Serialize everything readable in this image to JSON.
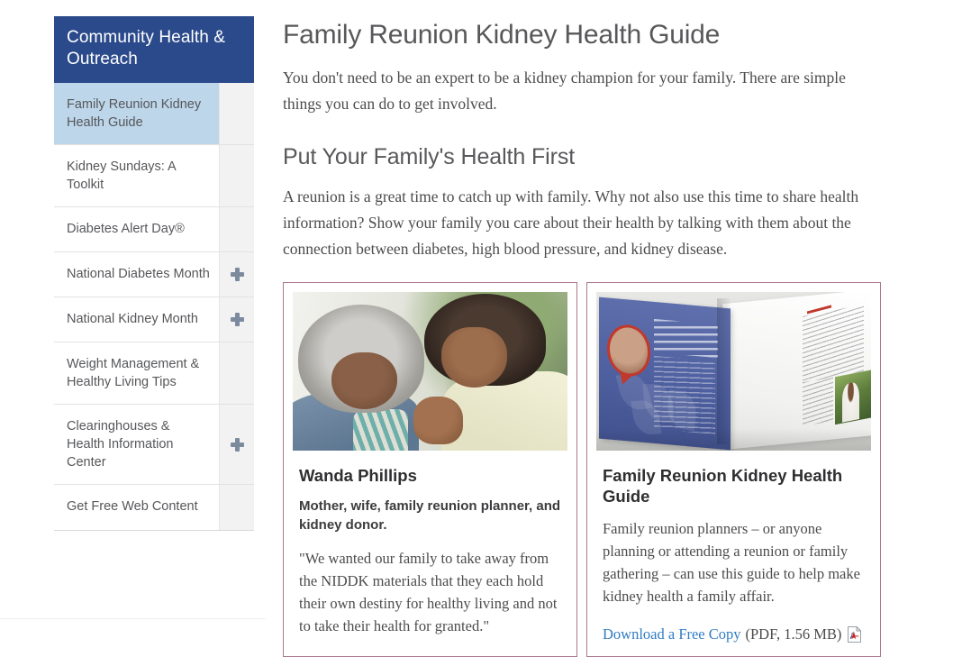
{
  "sidebar": {
    "heading": "Community Health & Outreach",
    "items": [
      {
        "label": "Family Reunion Kidney Health Guide",
        "active": true,
        "expandable": false,
        "toggle_icon": "plus-icon"
      },
      {
        "label": "Kidney Sundays: A Toolkit",
        "active": false,
        "expandable": false,
        "toggle_icon": "plus-icon"
      },
      {
        "label": "Diabetes Alert Day®",
        "active": false,
        "expandable": false,
        "toggle_icon": "plus-icon"
      },
      {
        "label": "National Diabetes Month",
        "active": false,
        "expandable": true,
        "toggle_icon": "plus-icon"
      },
      {
        "label": "National Kidney Month",
        "active": false,
        "expandable": true,
        "toggle_icon": "plus-icon"
      },
      {
        "label": "Weight Management & Healthy Living Tips",
        "active": false,
        "expandable": false,
        "toggle_icon": "plus-icon"
      },
      {
        "label": "Clearinghouses & Health Information Center",
        "active": false,
        "expandable": true,
        "toggle_icon": "plus-icon"
      },
      {
        "label": "Get Free Web Content",
        "active": false,
        "expandable": false,
        "toggle_icon": "plus-icon"
      }
    ]
  },
  "main": {
    "page_title": "Family Reunion Kidney Health Guide",
    "lede": "You don't need to be an expert to be a kidney champion for your family. There are simple things you can do to get involved.",
    "section_title": "Put Your Family's Health First",
    "section_para": "A reunion is a great time to catch up with family. Why not also use this time to share health information? Show your family you care about their health by talking with them about the connection between diabetes, high blood pressure, and kidney disease."
  },
  "cards": {
    "profile": {
      "image_alt": "Two women smiling together",
      "title": "Wanda Phillips",
      "subtitle": "Mother, wife, family reunion planner, and kidney donor.",
      "quote": "\"We wanted our family to take away from the NIDDK materials that they each hold their own destiny for healthy living and not to take their health for granted.\""
    },
    "guide": {
      "image_alt": "Open printed guide booklet showing Approach 3 pages",
      "title": "Family Reunion Kidney Health Guide",
      "text": "Family reunion planners – or anyone planning or attending a reunion or family gathering – can use this guide to help make kidney health a family affair.",
      "download_link": "Download a Free Copy",
      "download_meta": "(PDF, 1.56 MB)",
      "download_icon": "pdf-icon"
    }
  },
  "colors": {
    "sidebar_header_bg": "#2b4a8b",
    "sidebar_active_bg": "#bdd6ea",
    "sidebar_toggle_bg": "#f2f2f2",
    "plus_icon": "#7b8a9c",
    "card_border": "#a9788e",
    "link": "#2f7cc4",
    "heading_text": "#58585b",
    "body_text": "#4c4c4e",
    "pdf_icon_red": "#cc2222"
  }
}
